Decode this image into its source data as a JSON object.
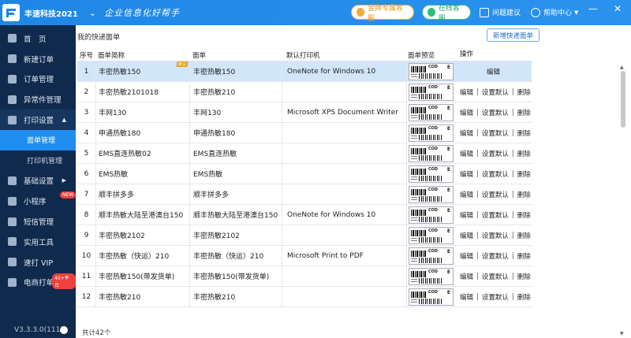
{
  "header": {
    "app_title": "丰速科技2021",
    "slogan": "企业信息化好帮手",
    "btn_gold": "金牌专属客服",
    "btn_online": "在线客服",
    "btn_feedback": "问题建议",
    "btn_help": "帮助中心",
    "win_min": "—",
    "win_close": "✕"
  },
  "sidebar": {
    "items": [
      {
        "label": "首　页",
        "icon": "home-icon"
      },
      {
        "label": "新建订单",
        "icon": "new-order-icon"
      },
      {
        "label": "订单管理",
        "icon": "order-icon"
      },
      {
        "label": "异常件管理",
        "icon": "exception-icon"
      },
      {
        "label": "打印设置",
        "icon": "printer-icon"
      },
      {
        "label": "面单管理"
      },
      {
        "label": "打印机管理"
      },
      {
        "label": "基础设置",
        "icon": "settings-icon"
      },
      {
        "label": "小程序",
        "icon": "miniapp-icon",
        "badge": "NEW"
      },
      {
        "label": "短信管理",
        "icon": "sms-icon"
      },
      {
        "label": "实用工具",
        "icon": "tools-icon"
      },
      {
        "label": "速打 VIP",
        "icon": "vip-icon"
      },
      {
        "label": "电商打单",
        "icon": "ecommerce-icon",
        "badge": "40+平台"
      }
    ],
    "version": "V3.3.3.0(111)"
  },
  "main": {
    "title": "我的快递面单",
    "add_button": "新增快递面单",
    "columns": {
      "no": "序号",
      "name": "面单简称",
      "sheet": "面单",
      "printer": "默认打印机",
      "preview": "面单预览",
      "ops": "操作"
    },
    "preview_cod": "COD",
    "preview_e": "E",
    "corner_tag": "默认",
    "op_edit": "编辑",
    "op_default": "设置默认",
    "op_delete": "删除",
    "op_sep": "|",
    "rows": [
      {
        "no": "1",
        "name": "丰密热敏150",
        "sheet": "丰密热敏150",
        "printer": "OneNote for Windows 10"
      },
      {
        "no": "2",
        "name": "丰密热敏2101018",
        "sheet": "丰密热敏210",
        "printer": ""
      },
      {
        "no": "3",
        "name": "丰网130",
        "sheet": "丰网130",
        "printer": "Microsoft XPS Document Writer"
      },
      {
        "no": "4",
        "name": "申通热敏180",
        "sheet": "申通热敏180",
        "printer": ""
      },
      {
        "no": "5",
        "name": "EMS直连热敏02",
        "sheet": "EMS直连热敏",
        "printer": ""
      },
      {
        "no": "6",
        "name": "EMS热敏",
        "sheet": "EMS热敏",
        "printer": ""
      },
      {
        "no": "7",
        "name": "顺丰拼多多",
        "sheet": "顺丰拼多多",
        "printer": ""
      },
      {
        "no": "8",
        "name": "顺丰热敏大陆至港澳台150",
        "sheet": "顺丰热敏大陆至港澳台150",
        "printer": "OneNote for Windows 10"
      },
      {
        "no": "9",
        "name": "丰密热敏2102",
        "sheet": "丰密热敏2102",
        "printer": ""
      },
      {
        "no": "10",
        "name": "丰密热敏（快运）210",
        "sheet": "丰密热敏（快运）210",
        "printer": "Microsoft Print to PDF"
      },
      {
        "no": "11",
        "name": "丰密热敏150(带发货单)",
        "sheet": "丰密热敏150(带发货单)",
        "printer": ""
      },
      {
        "no": "12",
        "name": "丰密热敏210",
        "sheet": "丰密热敏210",
        "printer": ""
      }
    ],
    "total": "共计42个"
  }
}
